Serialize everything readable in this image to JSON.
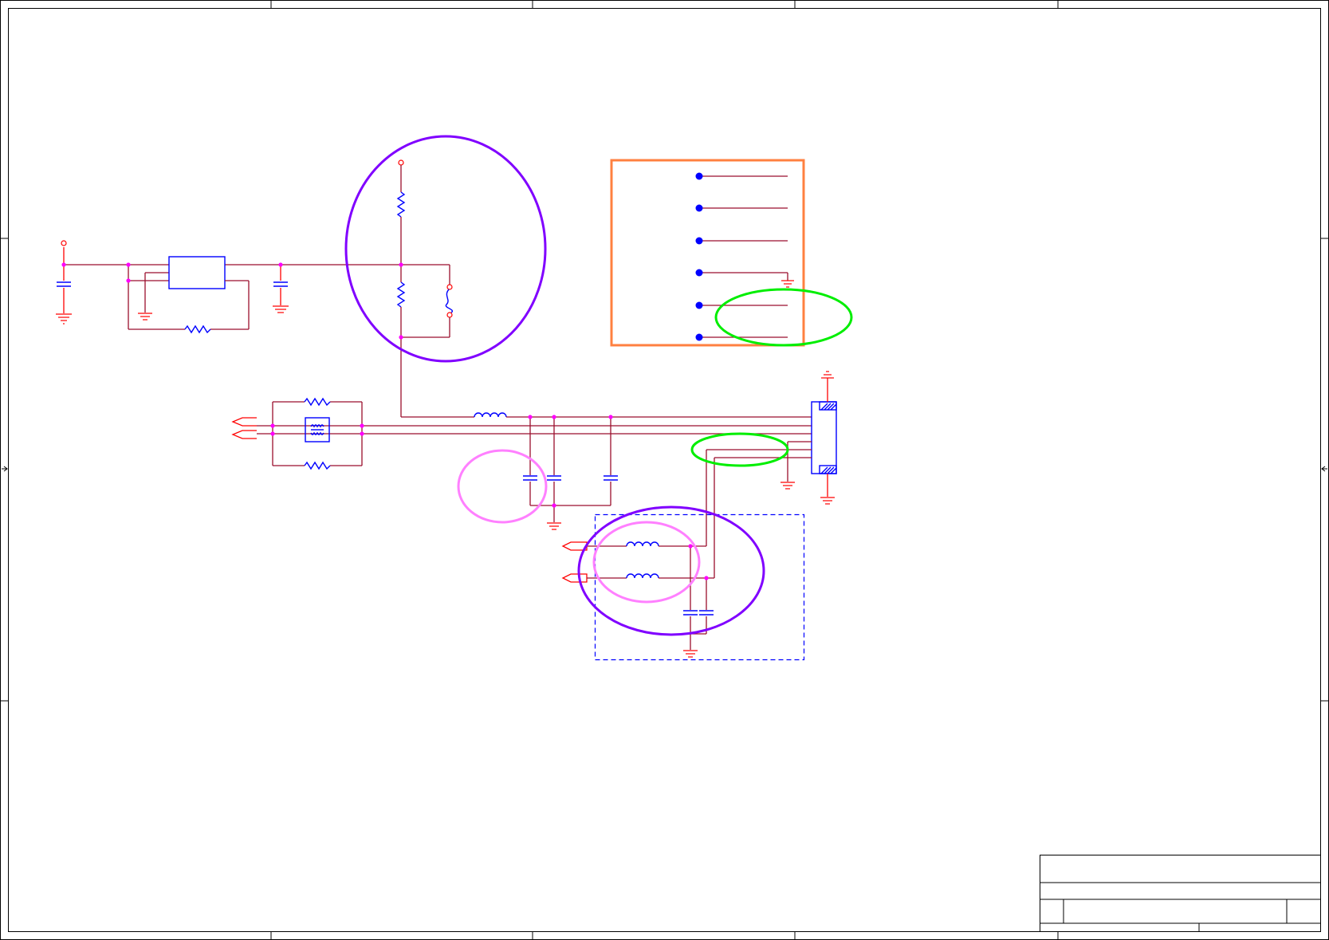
{
  "sheet": {
    "title": "",
    "zones_top": [
      "",
      "",
      "",
      "",
      ""
    ],
    "zones_side": [
      "",
      "",
      "",
      ""
    ]
  },
  "annotations": [
    {
      "name": "highlight-ellipse-purple-1",
      "color": "#8000ff"
    },
    {
      "name": "highlight-ellipse-purple-2",
      "color": "#8000ff"
    },
    {
      "name": "highlight-ellipse-green-1",
      "color": "#00ee00"
    },
    {
      "name": "highlight-ellipse-green-2",
      "color": "#00ee00"
    },
    {
      "name": "highlight-ellipse-pink-1",
      "color": "#ff80ff"
    },
    {
      "name": "highlight-ellipse-pink-2",
      "color": "#ff80ff"
    },
    {
      "name": "highlight-box-orange",
      "color": "#ff8040"
    }
  ],
  "colors": {
    "wire": "#9a0f2d",
    "net_red": "#ff0000",
    "component": "#0000ff",
    "junction": "#ff00ff",
    "frame": "#000000"
  },
  "title_block": {
    "company": "",
    "title": "",
    "size": "",
    "doc_number": "",
    "rev": "",
    "date": "",
    "sheet": ""
  }
}
